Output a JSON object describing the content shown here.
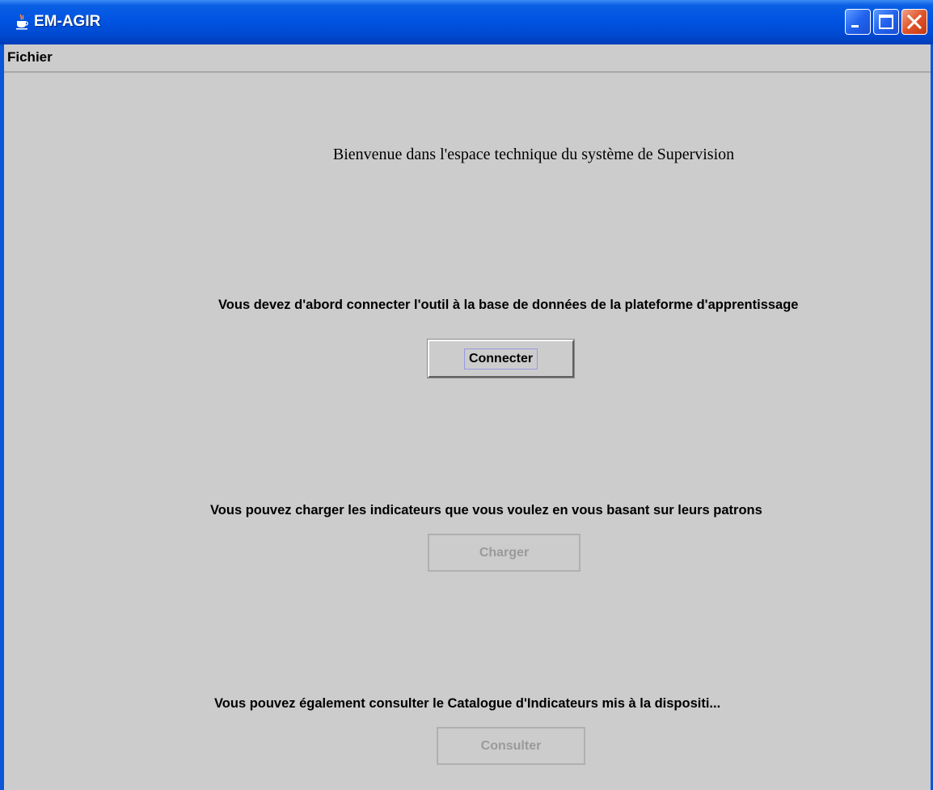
{
  "window": {
    "title": "EM-AGIR",
    "colors": {
      "titlebar": "#0054e3",
      "background": "#cccccc",
      "close": "#e0542b"
    },
    "icons": [
      "java-cup-icon",
      "minimize-icon",
      "maximize-icon",
      "close-icon"
    ]
  },
  "menubar": {
    "items": [
      {
        "label": "Fichier"
      }
    ]
  },
  "main": {
    "welcome": "Bienvenue dans l'espace technique du système de Supervision",
    "connect": {
      "message": "Vous devez d'abord connecter l'outil à la base de données de la plateforme d'apprentissage",
      "button": "Connecter",
      "enabled": true
    },
    "load": {
      "message": "Vous pouvez charger les indicateurs que vous voulez en vous basant sur leurs patrons",
      "button": "Charger",
      "enabled": false
    },
    "view": {
      "message": "Vous pouvez également consulter le Catalogue d'Indicateurs mis à la dispositi...",
      "button": "Consulter",
      "enabled": false
    }
  }
}
